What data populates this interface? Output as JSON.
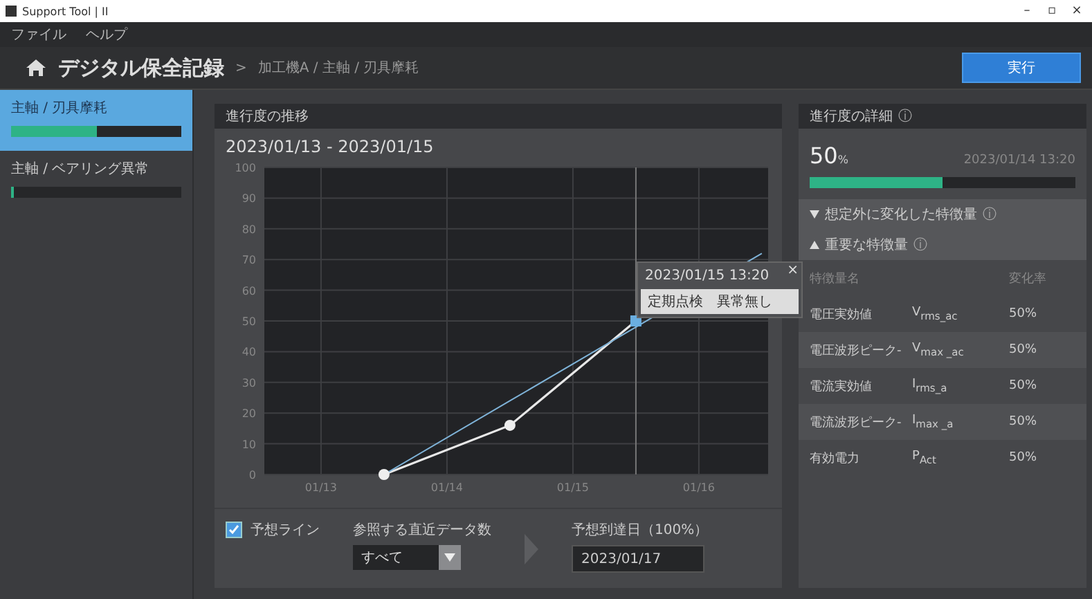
{
  "window": {
    "title": "Support Tool | II",
    "controls": [
      "–",
      "▫",
      "×"
    ]
  },
  "menu": [
    "ファイル",
    "ヘルプ"
  ],
  "header": {
    "title": "デジタル保全記録",
    "separator": ">",
    "breadcrumb": "加工機A / 主軸 / 刃具摩耗",
    "action": "実行"
  },
  "sidebar": {
    "items": [
      {
        "label": "主軸 / 刃具摩耗",
        "level": 0.5,
        "selected": true
      },
      {
        "label": "主軸 / ベアリング異常",
        "level": 0.01,
        "selected": false
      }
    ]
  },
  "progress_panel": {
    "title": "進行度の推移",
    "range": "2023/01/13 - 2023/01/15",
    "chart_data": {
      "type": "line",
      "categories": [
        "01/13",
        null,
        "01/14",
        null,
        "01/15",
        null,
        "01/16",
        null
      ],
      "ylim": [
        0,
        100
      ],
      "grid": true,
      "yticks": [
        0,
        10,
        20,
        30,
        40,
        50,
        60,
        70,
        80,
        90,
        100
      ],
      "series": [
        {
          "color": "#e8e8e8",
          "marker": "circle",
          "values": [
            null,
            0,
            null,
            16,
            null,
            50,
            null,
            null
          ]
        },
        {
          "color": "#7fb3d8",
          "values": [
            null,
            0,
            null,
            24,
            null,
            48,
            null,
            72
          ]
        }
      ]
    },
    "tooltip": {
      "time": "2023/01/15  13:20",
      "note": "定期点検　異常無し",
      "close": "×"
    },
    "forecast_line": {
      "label": "予想ライン",
      "checked": true
    },
    "reference": {
      "label": "参照する直近データ数",
      "value": "すべて"
    },
    "arrival": {
      "label": "予想到達日（100%）",
      "value": "2023/01/17"
    }
  },
  "detail_panel": {
    "title": "進行度の詳細",
    "info": "ⓘ",
    "percent": "50",
    "unit": "%",
    "time": "2023/01/14 13:20",
    "level": 0.5,
    "sections": [
      {
        "label": "想定外に変化した特徴量",
        "info": "ⓘ",
        "expanded": false
      },
      {
        "label": "重要な特徴量",
        "info": "ⓘ",
        "expanded": true
      }
    ],
    "columns": [
      "特徴量名",
      "変化率"
    ],
    "rows": [
      {
        "name": "電圧実効値",
        "symbol": "V$_{rms_ac}$",
        "rate": "50%"
      },
      {
        "name": "電圧波形ピーク-",
        "symbol": "V$_{max _ac}$",
        "rate": "50%"
      },
      {
        "name": "電流実効値",
        "symbol": "I$_{rms_a}$",
        "rate": "50%"
      },
      {
        "name": "電流波形ピーク-",
        "symbol": "I$_{max _a}$",
        "rate": "50%"
      },
      {
        "name": "有効電力",
        "symbol": "P$_{Act}$",
        "rate": "50%"
      }
    ]
  }
}
